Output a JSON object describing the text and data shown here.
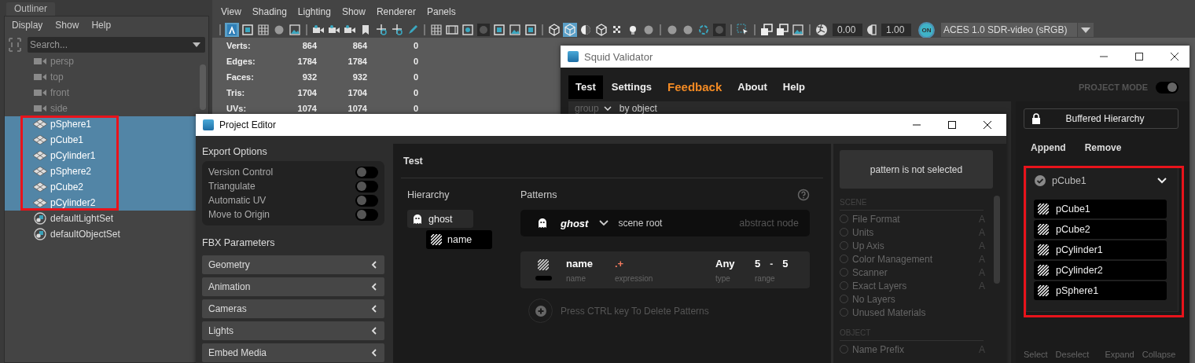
{
  "outliner": {
    "tab": "Outliner",
    "menu": [
      "Display",
      "Show",
      "Help"
    ],
    "search": {
      "placeholder": "Search..."
    },
    "items": [
      {
        "label": "persp",
        "kind": "camera",
        "selected": false
      },
      {
        "label": "top",
        "kind": "camera",
        "selected": false
      },
      {
        "label": "front",
        "kind": "camera",
        "selected": false
      },
      {
        "label": "side",
        "kind": "camera",
        "selected": false
      },
      {
        "label": "pSphere1",
        "kind": "mesh",
        "selected": true
      },
      {
        "label": "pCube1",
        "kind": "mesh",
        "selected": true
      },
      {
        "label": "pCylinder1",
        "kind": "mesh",
        "selected": true
      },
      {
        "label": "pSphere2",
        "kind": "mesh",
        "selected": true
      },
      {
        "label": "pCube2",
        "kind": "mesh",
        "selected": true
      },
      {
        "label": "pCylinder2",
        "kind": "mesh",
        "selected": true
      },
      {
        "label": "defaultLightSet",
        "kind": "set",
        "selected": false
      },
      {
        "label": "defaultObjectSet",
        "kind": "set",
        "selected": false
      }
    ]
  },
  "viewport": {
    "menu": [
      "View",
      "Shading",
      "Lighting",
      "Show",
      "Renderer",
      "Panels"
    ],
    "toolbar": [
      {
        "kind": "sep"
      },
      {
        "kind": "letter",
        "active": true
      },
      {
        "kind": "frame",
        "active": false
      },
      {
        "kind": "grid",
        "active": false
      },
      {
        "kind": "sphere",
        "active": false
      },
      {
        "kind": "picture",
        "active": false
      },
      {
        "kind": "sep"
      },
      {
        "kind": "camera",
        "active": false
      },
      {
        "kind": "camera",
        "active": false
      },
      {
        "kind": "camera",
        "active": false
      },
      {
        "kind": "bookmark",
        "active": false
      },
      {
        "kind": "axes",
        "active": false
      },
      {
        "kind": "axes",
        "active": false
      },
      {
        "kind": "pen",
        "active": false
      },
      {
        "kind": "sep"
      },
      {
        "kind": "grid",
        "active": false
      },
      {
        "kind": "film",
        "active": false
      },
      {
        "kind": "dotbox",
        "active": false
      },
      {
        "kind": "disc",
        "active": false
      },
      {
        "kind": "frame",
        "active": false
      },
      {
        "kind": "picture",
        "active": false
      },
      {
        "kind": "frame",
        "active": false
      },
      {
        "kind": "sep"
      },
      {
        "kind": "cube",
        "active": false
      },
      {
        "kind": "cube",
        "active": true
      },
      {
        "kind": "halfsphere",
        "active": false
      },
      {
        "kind": "cube",
        "active": false
      },
      {
        "kind": "checker",
        "active": false
      },
      {
        "kind": "bulb",
        "active": false
      },
      {
        "kind": "sphere",
        "active": false
      },
      {
        "kind": "sep"
      },
      {
        "kind": "sphere",
        "active": false
      },
      {
        "kind": "sphere",
        "active": false
      },
      {
        "kind": "ring",
        "active": false
      },
      {
        "kind": "disc",
        "active": false
      },
      {
        "kind": "sep"
      },
      {
        "kind": "select",
        "active": false
      },
      {
        "kind": "sep"
      },
      {
        "kind": "windows",
        "active": false
      },
      {
        "kind": "windows",
        "active": false
      },
      {
        "kind": "picture",
        "active": false
      },
      {
        "kind": "sep"
      }
    ],
    "exposure": "0.00",
    "gamma": "1.00",
    "view_transform": {
      "label": "ON",
      "on": true
    },
    "color_space": "ACES 1.0 SDR-video (sRGB)",
    "stats": [
      {
        "label": "Verts:",
        "values": [
          "864",
          "864",
          "0"
        ]
      },
      {
        "label": "Edges:",
        "values": [
          "1784",
          "1784",
          "0"
        ]
      },
      {
        "label": "Faces:",
        "values": [
          "932",
          "932",
          "0"
        ]
      },
      {
        "label": "Tris:",
        "values": [
          "1704",
          "1704",
          "0"
        ]
      },
      {
        "label": "UVs:",
        "values": [
          "1074",
          "1074",
          "0"
        ]
      }
    ]
  },
  "squid_validator": {
    "title": "Squid Validator",
    "tabs": [
      {
        "label": "Test",
        "selected": true,
        "kind": "plain"
      },
      {
        "label": "Settings",
        "selected": false,
        "kind": "plain"
      },
      {
        "label": "Feedback",
        "selected": false,
        "kind": "accent"
      },
      {
        "label": "About",
        "selected": false,
        "kind": "plain"
      },
      {
        "label": "Help",
        "selected": false,
        "kind": "plain"
      }
    ],
    "project_mode": {
      "label": "PROJECT MODE",
      "on": true
    },
    "group_field": {
      "value": "group"
    },
    "group_by": "by object",
    "buffer_button": "Buffered Hierarchy",
    "actions": [
      "Append",
      "Remove"
    ],
    "tree": {
      "label": "pCube1",
      "checked": true,
      "expanded": true,
      "children": [
        {
          "label": "pCube1"
        },
        {
          "label": "pCube2"
        },
        {
          "label": "pCylinder1"
        },
        {
          "label": "pCylinder2"
        },
        {
          "label": "pSphere1"
        }
      ]
    },
    "footer": [
      "Select",
      "Deselect",
      "Expand",
      "Collapse"
    ]
  },
  "project_editor": {
    "title": "Project Editor",
    "export_options": {
      "title": "Export Options",
      "toggles": [
        {
          "label": "Version Control",
          "on": false
        },
        {
          "label": "Triangulate",
          "on": false
        },
        {
          "label": "Automatic UV",
          "on": false
        },
        {
          "label": "Move to Origin",
          "on": false
        }
      ]
    },
    "fbx_parameters": {
      "title": "FBX Parameters",
      "sections": [
        {
          "label": "Geometry",
          "expanded": false
        },
        {
          "label": "Animation",
          "expanded": false
        },
        {
          "label": "Cameras",
          "expanded": false
        },
        {
          "label": "Lights",
          "expanded": false
        },
        {
          "label": "Embed Media",
          "expanded": false
        }
      ]
    },
    "test": {
      "title": "Test",
      "hierarchy": {
        "title": "Hierarchy",
        "root": {
          "label": "ghost",
          "children": [
            {
              "label": "name"
            }
          ]
        }
      },
      "patterns": {
        "title": "Patterns",
        "root": {
          "label": "ghost",
          "description": "scene root",
          "type": "abstract node"
        },
        "rows": [
          {
            "name": "name",
            "expression": ".+",
            "type": "Any",
            "range_min": "5",
            "range_separator": "-",
            "range_max": "5",
            "captions": {
              "name": "name",
              "expression": "expression",
              "type": "type",
              "range": "range"
            }
          }
        ],
        "hint": "Press CTRL key To Delete Patterns"
      }
    },
    "inspector": {
      "message": "pattern is not selected",
      "sections": [
        {
          "title": "SCENE",
          "items": [
            {
              "label": "File Format",
              "badge": "A",
              "selected": false
            },
            {
              "label": "Units",
              "badge": "A",
              "selected": false
            },
            {
              "label": "Up Axis",
              "badge": "A",
              "selected": false
            },
            {
              "label": "Color Management",
              "badge": "A",
              "selected": false
            },
            {
              "label": "Scanner",
              "badge": "A",
              "selected": false
            },
            {
              "label": "Exact Layers",
              "badge": "A",
              "selected": false
            },
            {
              "label": "No Layers",
              "selected": false
            },
            {
              "label": "Unused Materials",
              "selected": false
            }
          ]
        },
        {
          "title": "OBJECT",
          "items": [
            {
              "label": "Name Prefix",
              "badge": "A",
              "selected": false
            }
          ]
        }
      ]
    }
  }
}
